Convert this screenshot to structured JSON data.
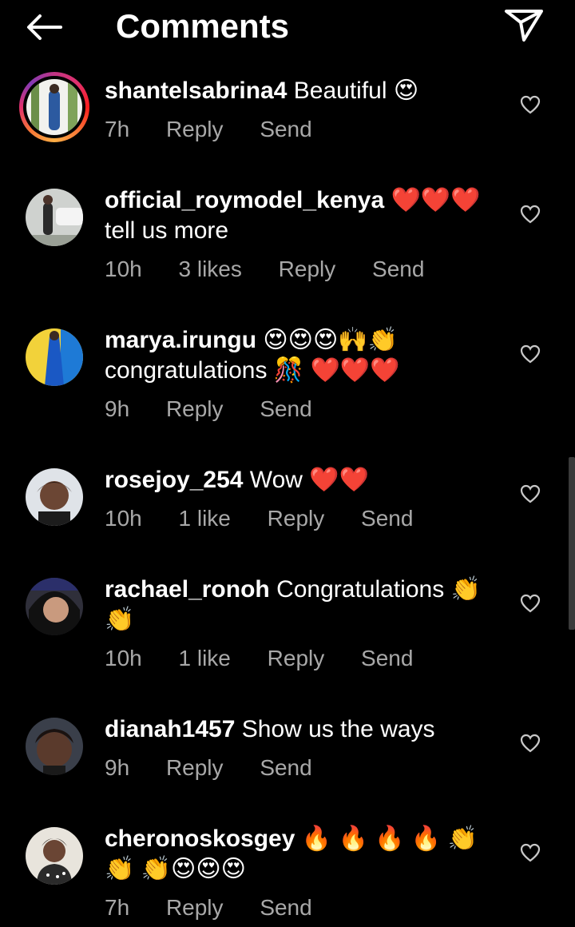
{
  "header": {
    "title": "Comments",
    "back_icon": "arrow-left-icon",
    "send_icon": "paper-plane-icon"
  },
  "colors": {
    "background": "#000000",
    "text": "#ffffff",
    "meta": "#a8a8a8",
    "heart_emoji": "#e0162b"
  },
  "comments": [
    {
      "username": "shantelsabrina4",
      "text": "Beautiful 😍",
      "time": "7h",
      "likes": "",
      "reply": "Reply",
      "send": "Send",
      "story_ring": true
    },
    {
      "username": "official_roymodel_kenya",
      "text": "❤️❤️❤️ tell us more",
      "time": "10h",
      "likes": "3 likes",
      "reply": "Reply",
      "send": "Send"
    },
    {
      "username": "marya.irungu",
      "text": "😍😍😍🙌👏 congratulations 🎊 ❤️❤️❤️",
      "time": "9h",
      "likes": "",
      "reply": "Reply",
      "send": "Send"
    },
    {
      "username": "rosejoy_254",
      "text": "Wow ❤️❤️",
      "time": "10h",
      "likes": "1 like",
      "reply": "Reply",
      "send": "Send"
    },
    {
      "username": "rachael_ronoh",
      "text": "Congratulations 👏 👏",
      "time": "10h",
      "likes": "1 like",
      "reply": "Reply",
      "send": "Send"
    },
    {
      "username": "dianah1457",
      "text": "Show us the ways",
      "time": "9h",
      "likes": "",
      "reply": "Reply",
      "send": "Send"
    },
    {
      "username": "cheronoskosgey",
      "text": "🔥 🔥 🔥 🔥 👏 👏 👏😍😍😍",
      "time": "7h",
      "likes": "",
      "reply": "Reply",
      "send": "Send"
    }
  ]
}
